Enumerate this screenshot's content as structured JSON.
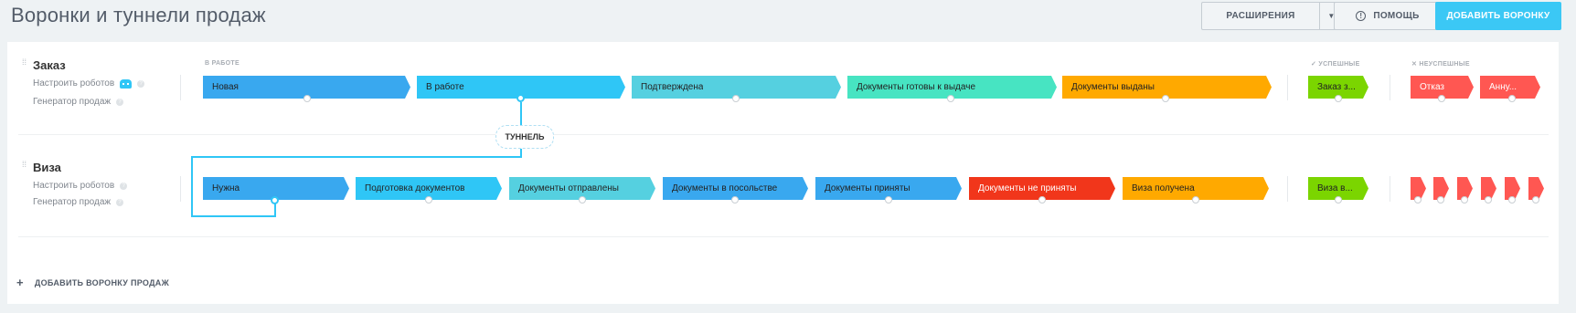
{
  "page": {
    "title": "Воронки и туннели продаж"
  },
  "toolbar": {
    "extensions_label": "РАСШИРЕНИЯ",
    "help_label": "ПОМОЩЬ",
    "add_funnel_label": "ДОБАВИТЬ ВОРОНКУ"
  },
  "sections": {
    "in_work": "В РАБОТЕ",
    "successful": "УСПЕШНЫЕ",
    "unsuccessful": "НЕУСПЕШНЫЕ"
  },
  "funnels": [
    {
      "name": "Заказ",
      "robots_link": "Настроить роботов",
      "generator_link": "Генератор продаж",
      "stages": [
        {
          "label": "Новая",
          "color": "#39a8ef"
        },
        {
          "label": "В работе",
          "color": "#2fc6f6"
        },
        {
          "label": "Подтверждена",
          "color": "#55d0e0"
        },
        {
          "label": "Документы готовы к выдаче",
          "color": "#47e4c2"
        },
        {
          "label": "Документы выданы",
          "color": "#ffa900"
        }
      ],
      "success": [
        {
          "label": "Заказ з...",
          "color": "#7bd500"
        }
      ],
      "fail": [
        {
          "label": "Отказ",
          "color": "#ff5752"
        },
        {
          "label": "Анну...",
          "color": "#ff5752"
        }
      ]
    },
    {
      "name": "Виза",
      "robots_link": "Настроить роботов",
      "generator_link": "Генератор продаж",
      "stages": [
        {
          "label": "Нужна",
          "color": "#39a8ef"
        },
        {
          "label": "Подготовка документов",
          "color": "#2fc6f6"
        },
        {
          "label": "Документы отправлены",
          "color": "#55d0e0"
        },
        {
          "label": "Документы в посольстве",
          "color": "#39a8ef"
        },
        {
          "label": "Документы приняты",
          "color": "#39a8ef"
        },
        {
          "label": "Документы не приняты",
          "color": "#f1361b"
        },
        {
          "label": "Виза получена",
          "color": "#ffa900"
        }
      ],
      "success": [
        {
          "label": "Виза в...",
          "color": "#7bd500"
        }
      ],
      "fail_count": 6
    }
  ],
  "tunnel": {
    "label": "ТУННЕЛЬ"
  },
  "footer": {
    "add_sales_funnel": "ДОБАВИТЬ ВОРОНКУ ПРОДАЖ"
  }
}
